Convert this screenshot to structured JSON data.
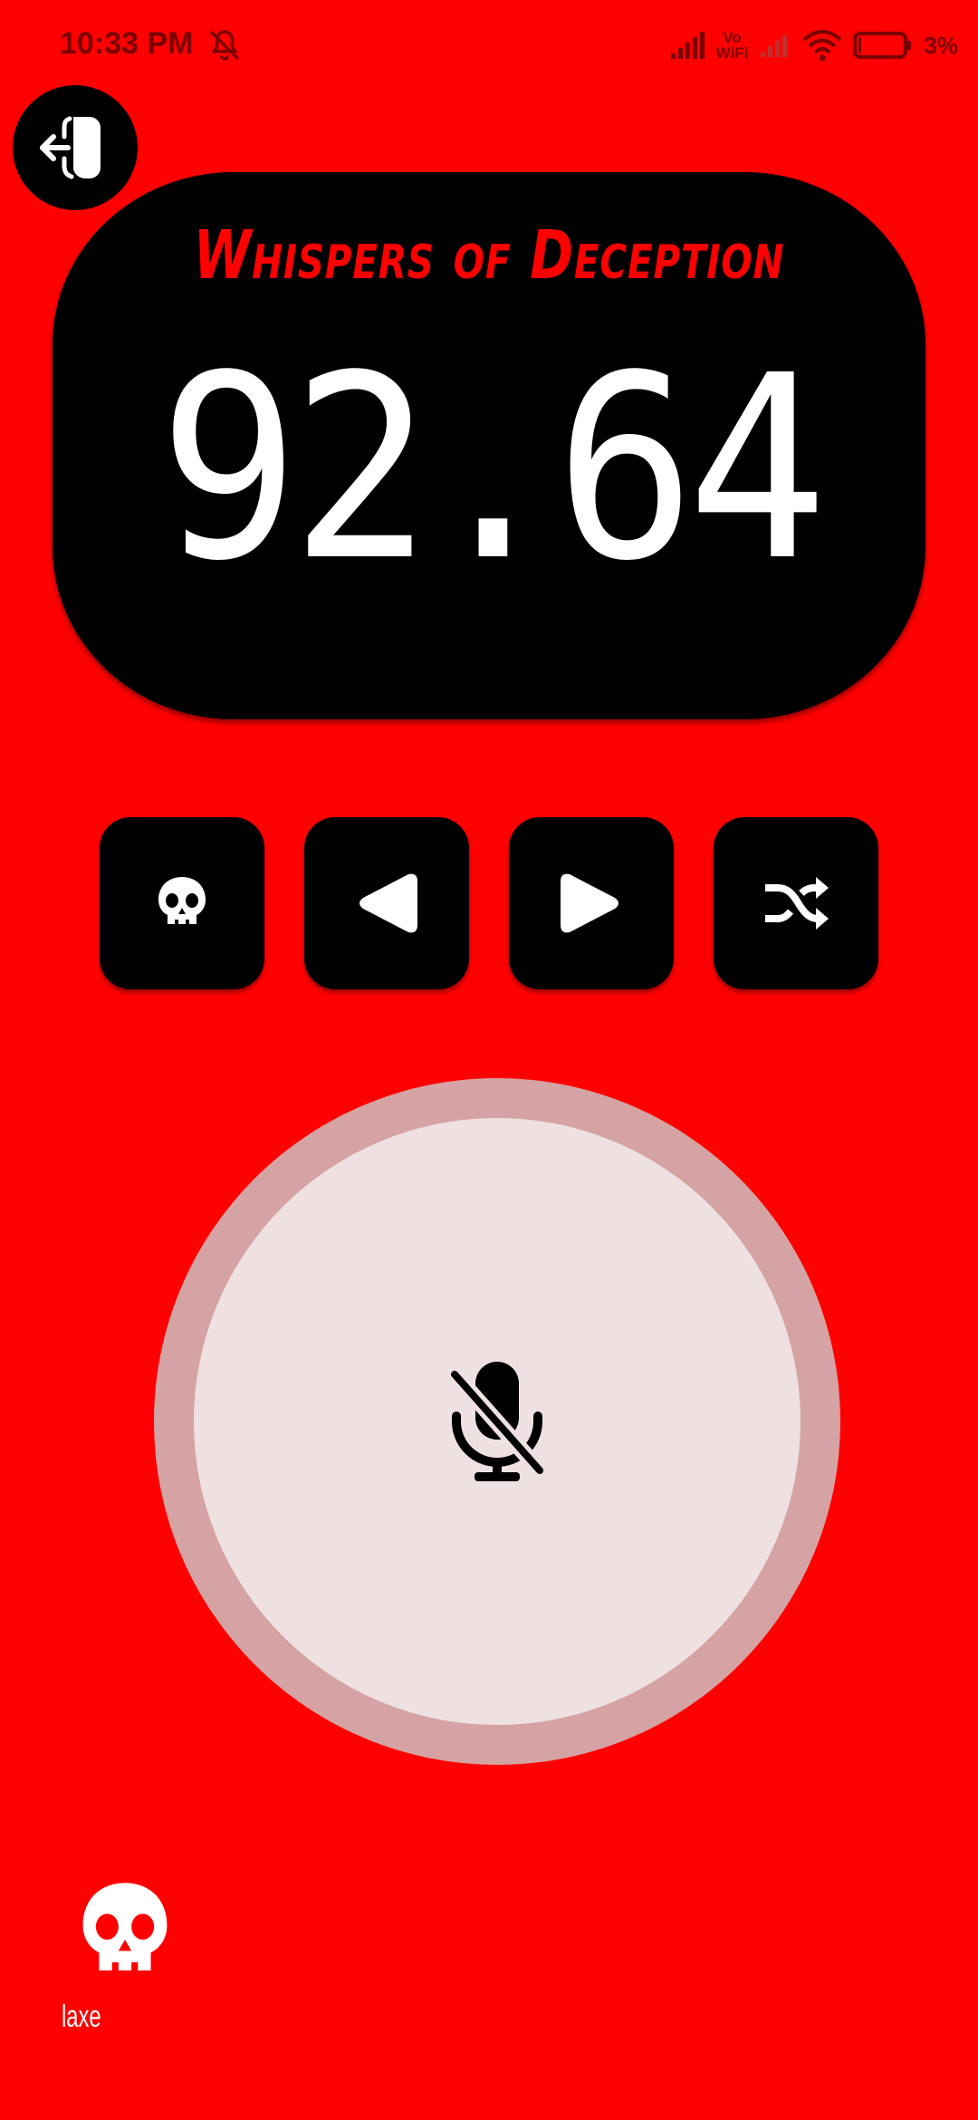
{
  "status_bar": {
    "time": "10:33 PM",
    "network_label_top": "Vo",
    "network_label_bottom": "WiFi",
    "battery": "3%",
    "icons": [
      "dnd-off-icon",
      "signal-icon",
      "vowifi-icon",
      "signal-weak-icon",
      "wifi-icon",
      "battery-icon"
    ]
  },
  "exit_button": {
    "icon": "exit-door-icon"
  },
  "display": {
    "title": "Whispers of Deception",
    "frequency": "92.64"
  },
  "controls": [
    {
      "name": "skull-button",
      "icon": "skull-icon"
    },
    {
      "name": "previous-button",
      "icon": "triangle-left-icon"
    },
    {
      "name": "next-button",
      "icon": "triangle-right-icon"
    },
    {
      "name": "shuffle-button",
      "icon": "shuffle-icon"
    }
  ],
  "push_to_talk": {
    "icon": "mic-off-icon"
  },
  "user": {
    "name": "laxe",
    "icon": "skull-icon"
  },
  "colors": {
    "background": "#ff0000",
    "panel": "#000000",
    "title": "#ff0000",
    "frequency": "#ffffff",
    "ptt_ring": "#d5a3a3",
    "ptt_fill": "#efe0e1"
  }
}
